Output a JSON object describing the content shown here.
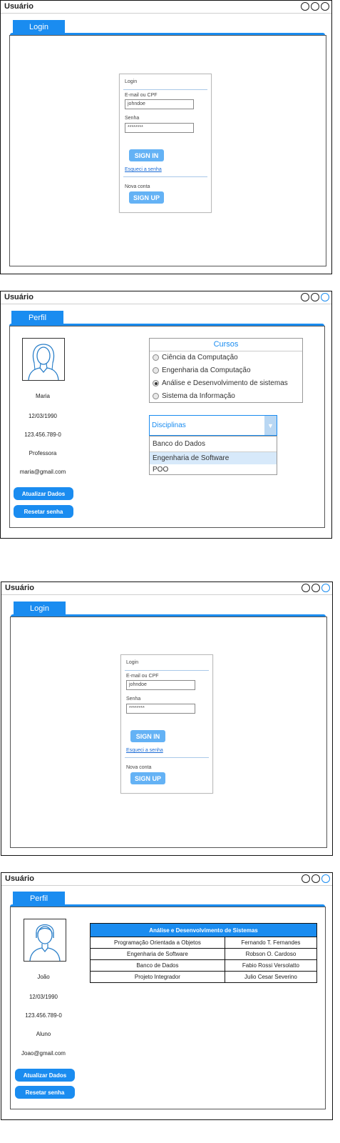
{
  "screens": [
    {
      "window_title": "Usuário",
      "tab": "Login",
      "login": {
        "section_title": "Login",
        "email_label": "E-mail ou CPF",
        "email_value": "johndoe",
        "password_label": "Senha",
        "password_value": "********",
        "signin_label": "SIGN IN",
        "forgot_link": "Esqueci a senha",
        "new_account_label": "Nova conta",
        "signup_label": "SIGN UP"
      }
    },
    {
      "window_title": "Usuário",
      "tab": "Perfil",
      "profile": {
        "name": "Maria",
        "birthdate": "12/03/1990",
        "cpf": "123.456.789-0",
        "role": "Professora",
        "email": "maria@gmail.com",
        "update_button": "Atualizar Dados",
        "reset_button": "Resetar senha"
      },
      "cursos": {
        "title": "Cursos",
        "options": [
          {
            "label": "Ciência da Computação",
            "selected": false
          },
          {
            "label": "Engenharia da Computação",
            "selected": false
          },
          {
            "label": "Análise e Desenvolvimento de sistemas",
            "selected": true
          },
          {
            "label": "Sistema da Informação",
            "selected": false
          }
        ]
      },
      "disciplinas": {
        "label": "Disciplinas",
        "items": [
          {
            "label": "Banco do Dados",
            "selected": false
          },
          {
            "label": "Engenharia de Software",
            "selected": true
          },
          {
            "label": "POO",
            "selected": false
          }
        ]
      }
    },
    {
      "window_title": "Usuário",
      "tab": "Login",
      "login": {
        "section_title": "Login",
        "email_label": "E-mail ou CPF",
        "email_value": "johndoe",
        "password_label": "Senha",
        "password_value": "********",
        "signin_label": "SIGN IN",
        "forgot_link": "Esqueci a senha",
        "new_account_label": "Nova conta",
        "signup_label": "SIGN UP"
      }
    },
    {
      "window_title": "Usuário",
      "tab": "Perfil",
      "profile": {
        "name": "João",
        "birthdate": "12/03/1990",
        "cpf": "123.456.789-0",
        "role": "Aluno",
        "email": "Joao@gmail.com",
        "update_button": "Atualizar Dados",
        "reset_button": "Resetar senha"
      },
      "table": {
        "title": "Análise e Desenvolvimento de Sistemas",
        "rows": [
          [
            "Programação Orientada a Objetos",
            "Fernando T. Fernandes"
          ],
          [
            "Engenharia de Software",
            "Robson O. Cardoso"
          ],
          [
            "Banco de Dados",
            "Fabio Rossi Versolatto"
          ],
          [
            "Projeto Integrador",
            "Julio Cesar Severino"
          ]
        ]
      }
    }
  ],
  "colors": {
    "accent": "#1a8cf0",
    "button_light": "#64b2f5"
  },
  "icons": [
    "window-circle-icon",
    "female-avatar-icon",
    "male-avatar-icon",
    "dropdown-arrow-icon"
  ]
}
